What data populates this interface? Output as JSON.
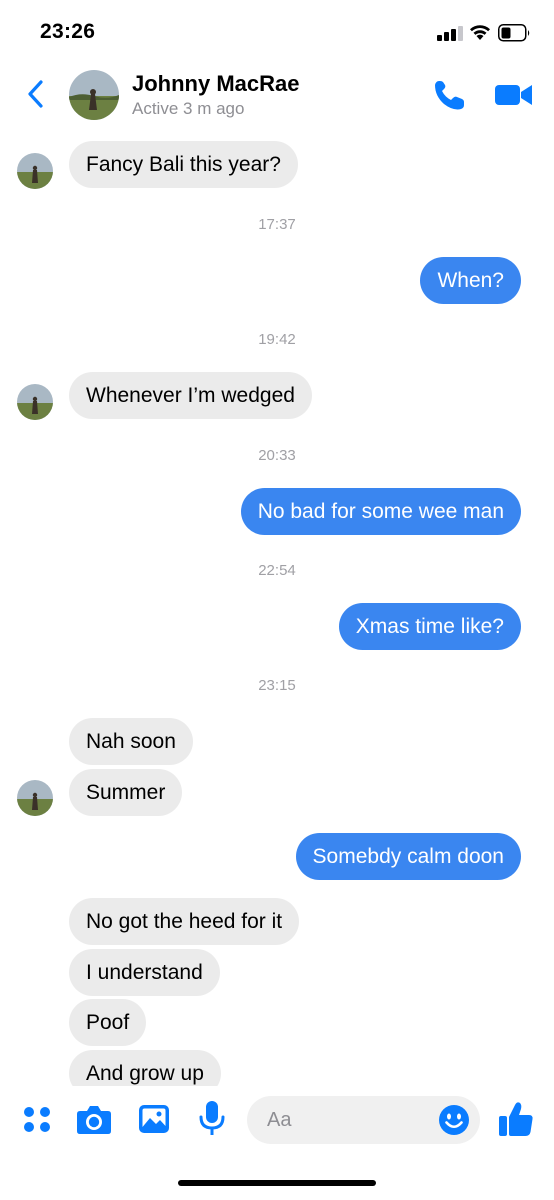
{
  "status_bar": {
    "time": "23:26"
  },
  "header": {
    "contact_name": "Johnny MacRae",
    "contact_status": "Active 3 m ago"
  },
  "colors": {
    "accent": "#0a7cff",
    "outgoing_bubble": "#3a86f0",
    "incoming_bubble": "#ebebeb",
    "timestamp_text": "#a0a0a5"
  },
  "conversation": [
    {
      "type": "incoming",
      "text": "Fancy Bali this year?",
      "show_avatar": true
    },
    {
      "type": "timestamp",
      "text": "17:37"
    },
    {
      "type": "outgoing",
      "text": "When?"
    },
    {
      "type": "timestamp",
      "text": "19:42"
    },
    {
      "type": "incoming",
      "text": "Whenever I’m wedged",
      "show_avatar": true
    },
    {
      "type": "timestamp",
      "text": "20:33"
    },
    {
      "type": "outgoing",
      "text": "No bad for some wee man"
    },
    {
      "type": "timestamp",
      "text": "22:54"
    },
    {
      "type": "outgoing",
      "text": "Xmas time like?"
    },
    {
      "type": "timestamp",
      "text": "23:15"
    },
    {
      "type": "incoming",
      "text": "Nah soon",
      "show_avatar": false
    },
    {
      "type": "incoming",
      "text": "Summer",
      "show_avatar": true
    },
    {
      "type": "outgoing",
      "text": "Somebdy calm doon"
    },
    {
      "type": "incoming",
      "text": "No got the heed for it",
      "show_avatar": false
    },
    {
      "type": "incoming",
      "text": "I understand",
      "show_avatar": false
    },
    {
      "type": "incoming",
      "text": "Poof",
      "show_avatar": false
    },
    {
      "type": "incoming",
      "text": "And grow up",
      "show_avatar": false
    }
  ],
  "composer": {
    "placeholder": "Aa",
    "icons": [
      "apps-icon",
      "camera-icon",
      "photo-icon",
      "microphone-icon",
      "emoji-icon",
      "thumbs-up-icon"
    ]
  }
}
